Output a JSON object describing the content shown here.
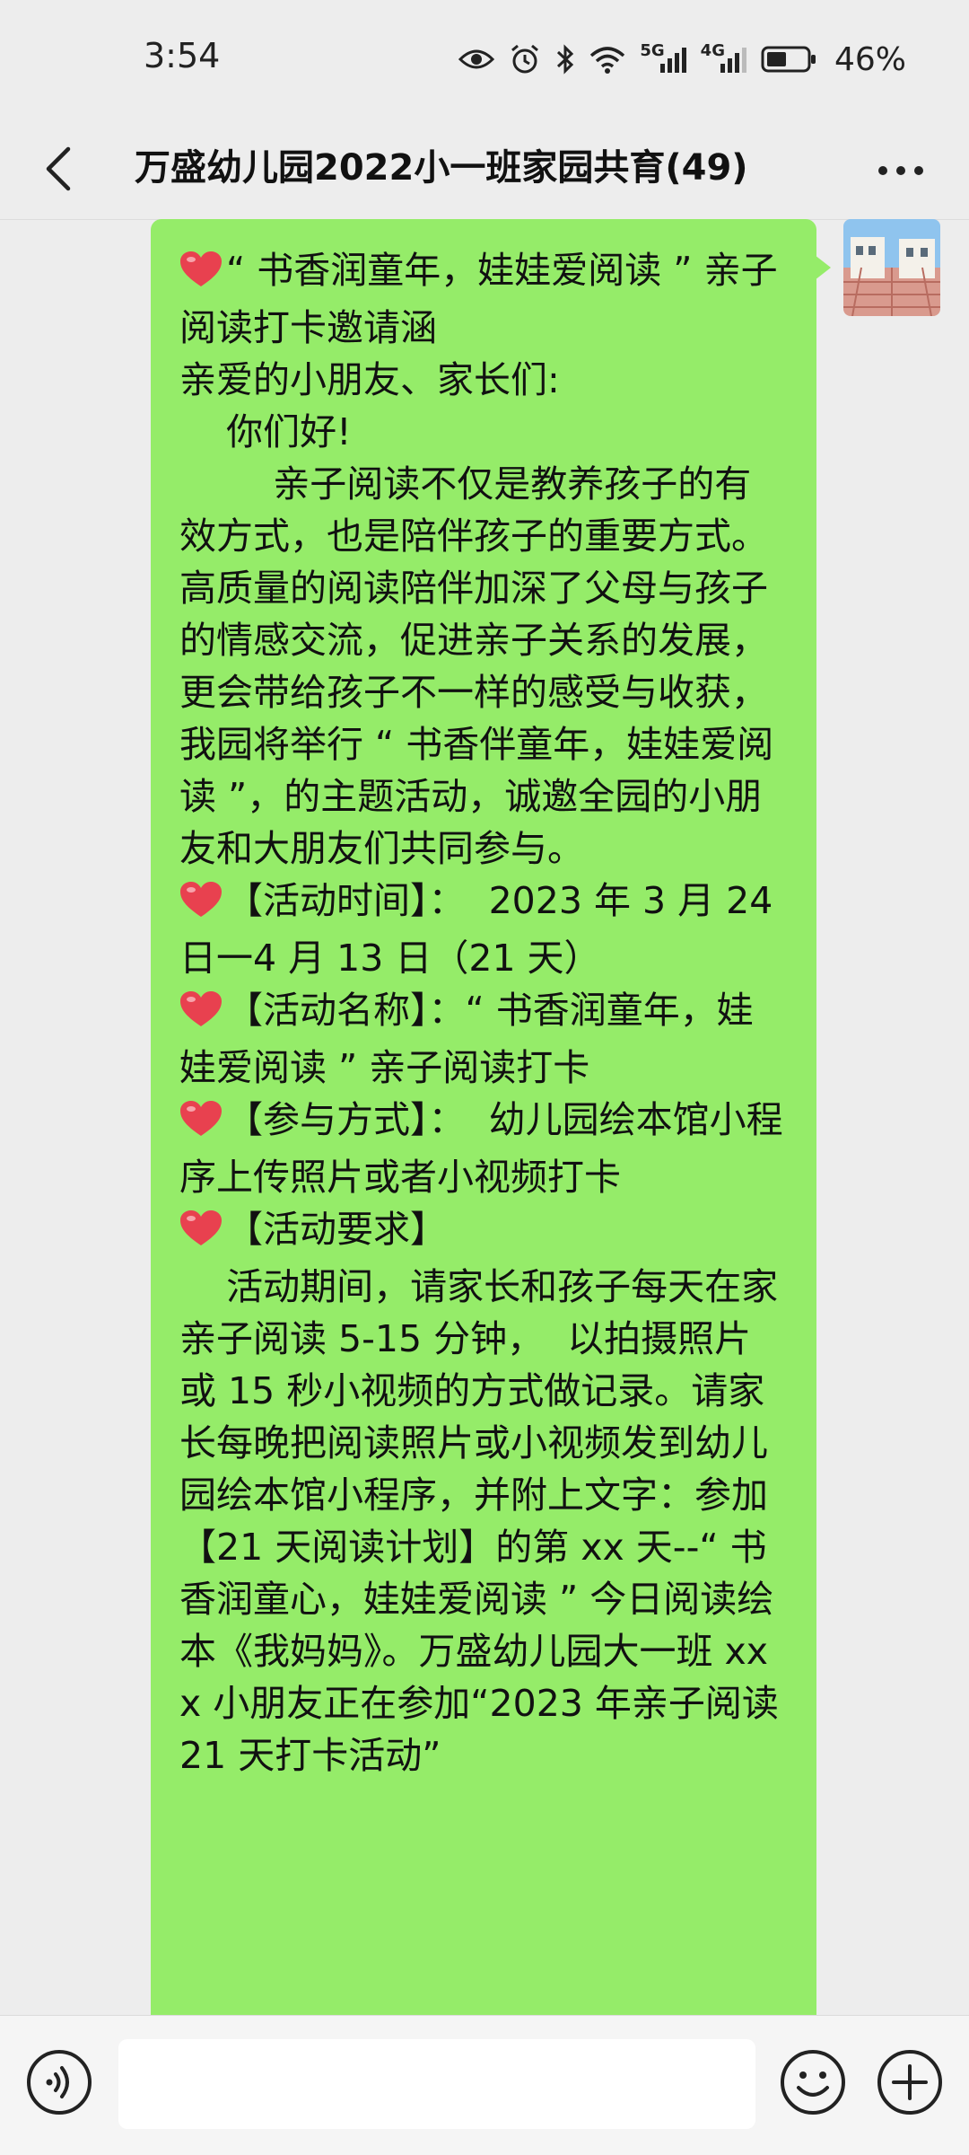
{
  "status_bar": {
    "time": "3:54",
    "network_1": "5G",
    "network_2": "4G",
    "battery": "46%"
  },
  "header": {
    "title": "万盛幼儿园2022小一班家园共育(49)"
  },
  "message": {
    "paragraphs": [
      "“ 书香润童年，娃娃爱阅读 ” 亲子阅读打卡邀请涵",
      "亲爱的小朋友、家长们:",
      "    你们好!",
      "        亲子阅读不仅是教养孩子的有效方式，也是陪伴孩子的重要方式。高质量的阅读陪伴加深了父母与孩子的情感交流，促进亲子关系的发展，更会带给孩子不一样的感受与收获，我园将举行 “ 书香伴童年，娃娃爱阅读 ”，的主题活动，诚邀全园的小朋友和大朋友们共同参与。",
      "",
      "【活动时间】：  2023 年 3 月 24 日一4 月 13 日（21 天）",
      "",
      "【活动名称】：“ 书香润童年，娃娃爱阅读 ” 亲子阅读打卡",
      "",
      "【参与方式】：  幼儿园绘本馆小程序上传照片或者小视频打卡",
      "",
      "【活动要求】",
      "    活动期间，请家长和孩子每天在家亲子阅读 5-15 分钟，  以拍摄照片或 15 秒小视频的方式做记录。请家长每晚把阅读照片或小视频发到幼儿园绘本馆小程序，并附上文字：参加【21 天阅读计划】的第 xx 天--“ 书香润童心，娃娃爱阅读 ” 今日阅读绘本《我妈妈》。万盛幼儿园大一班 xxx 小朋友正在参加“2023 年亲子阅读 21 天打卡活动”"
    ]
  },
  "input": {
    "placeholder": ""
  },
  "icons": {
    "back": "back-chevron-icon",
    "more": "more-dots-icon",
    "heart": "heart-emoji-icon",
    "voice": "voice-icon",
    "emoji": "emoji-icon",
    "plus": "plus-icon"
  },
  "colors": {
    "bubble": "#95ec69",
    "background": "#ededed",
    "heart": "#e8414f"
  }
}
